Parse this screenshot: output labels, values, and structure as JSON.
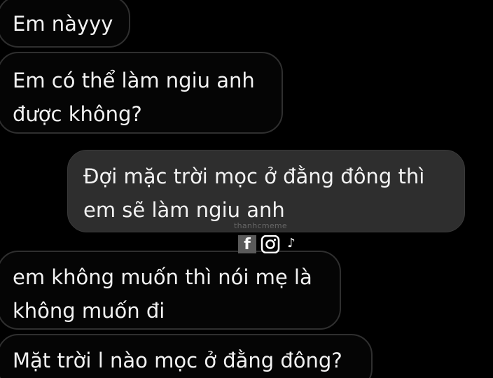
{
  "messages": [
    {
      "side": "incoming",
      "text": "Em nàyyy"
    },
    {
      "side": "incoming",
      "text": "Em có thể làm ngiu anh\nđược không?"
    },
    {
      "side": "outgoing",
      "text": "Đợi mặc trời mọc ở đằng đông thì\nem sẽ làm ngiu anh"
    },
    {
      "side": "incoming",
      "text": "em không muốn thì nói mẹ là\nkhông muốn đi"
    },
    {
      "side": "incoming",
      "text": "Mặt trời l nào mọc ở đằng đông?"
    }
  ],
  "watermark": {
    "text": "thanhcmeme",
    "icons": [
      "facebook-icon",
      "instagram-icon",
      "tiktok-icon"
    ],
    "facebook_glyph": "f",
    "tiktok_glyph": "♪"
  },
  "colors": {
    "background": "#000000",
    "incoming_bubble": "#050505",
    "incoming_border": "#2f2f2f",
    "outgoing_bubble": "#2e2e2e",
    "text": "#f2f2f2"
  }
}
